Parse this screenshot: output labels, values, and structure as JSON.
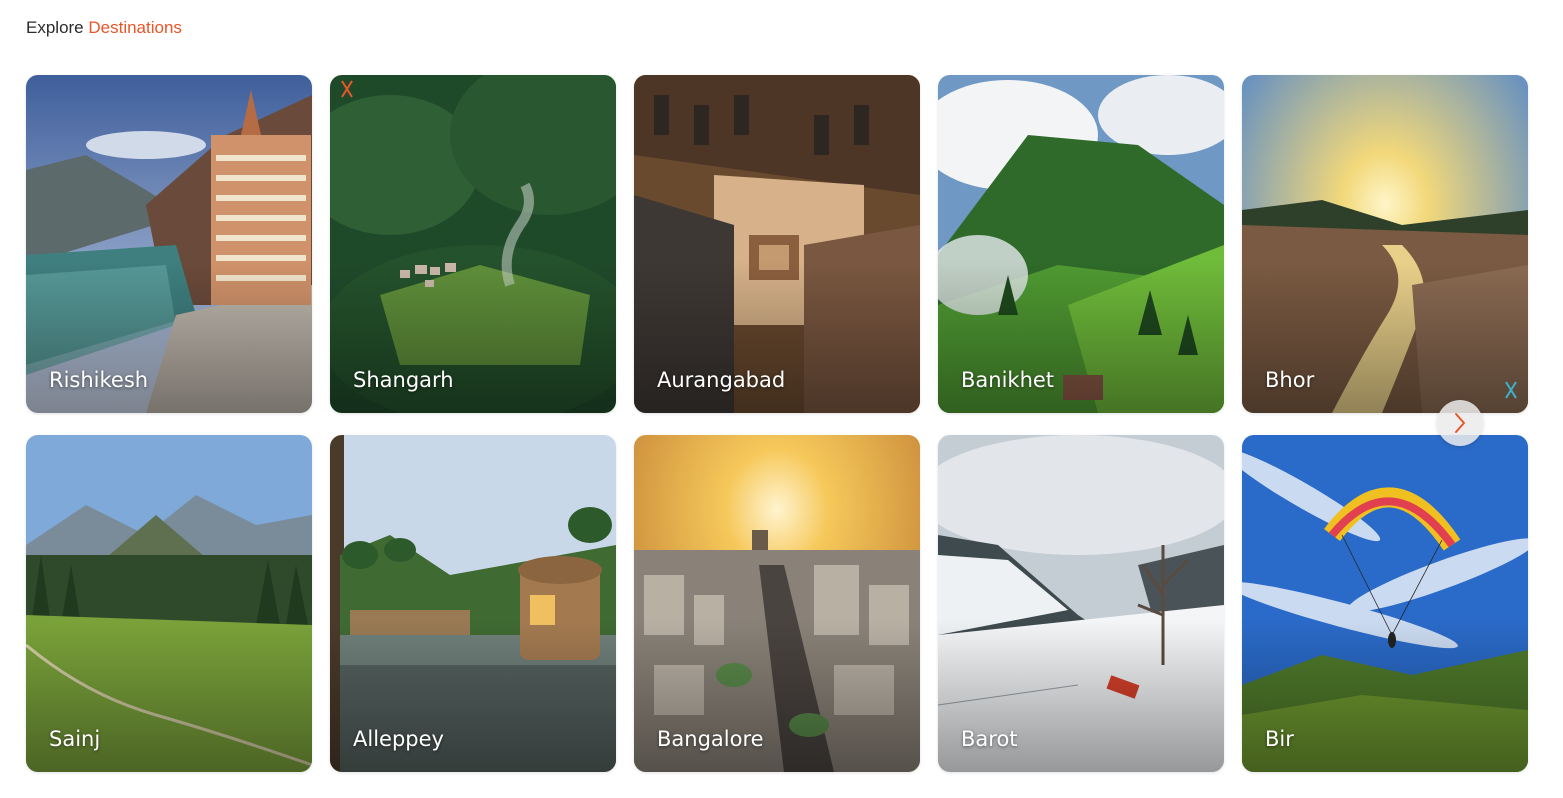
{
  "header": {
    "prefix": "Explore",
    "accent": "Destinations"
  },
  "accent_color": "#e8562a",
  "destinations": [
    {
      "name": "Rishikesh"
    },
    {
      "name": "Shangarh"
    },
    {
      "name": "Aurangabad"
    },
    {
      "name": "Banikhet"
    },
    {
      "name": "Bhor"
    },
    {
      "name": "Sainj"
    },
    {
      "name": "Alleppey"
    },
    {
      "name": "Bangalore"
    },
    {
      "name": "Barot"
    },
    {
      "name": "Bir"
    }
  ],
  "carousel": {
    "next_icon": "chevron-right-icon"
  }
}
